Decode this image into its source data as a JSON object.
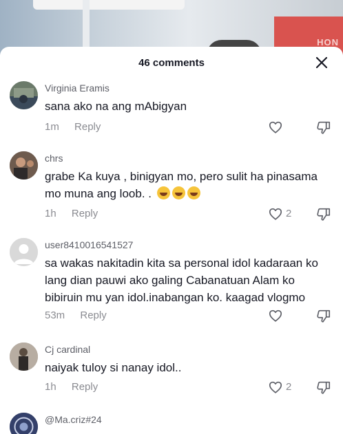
{
  "sheet": {
    "title": "46 comments"
  },
  "comments": [
    {
      "author": "Virginia Eramis",
      "text": "sana ako na ang mAbigyan",
      "time": "1m",
      "reply": "Reply",
      "likes": "",
      "avatar_color": "#6b7a6a"
    },
    {
      "author": "chrs",
      "text": "grabe Ka kuya , binigyan mo, pero sulit ha pinasama mo muna ang loob. .",
      "emoji_count": 3,
      "time": "1h",
      "reply": "Reply",
      "likes": "2",
      "avatar_color": "#5a4b43"
    },
    {
      "author": "user8410016541527",
      "text": "sa wakas nakitadin kita sa personal idol kadaraan ko lang dian pauwi ako galing Cabanatuan Alam ko bibiruin mu yan idol.inabangan ko. kaagad vlogmo",
      "time": "53m",
      "reply": "Reply",
      "likes": "",
      "avatar_color": "#d6d6d6"
    },
    {
      "author": "Cj cardinal",
      "text": "naiyak tuloy si nanay idol..",
      "time": "1h",
      "reply": "Reply",
      "likes": "2",
      "avatar_color": "#8a8076"
    },
    {
      "author": "@Ma.criz#24",
      "text": "",
      "time": "",
      "reply": "",
      "likes": "",
      "avatar_color": "#2e3a5c"
    }
  ]
}
